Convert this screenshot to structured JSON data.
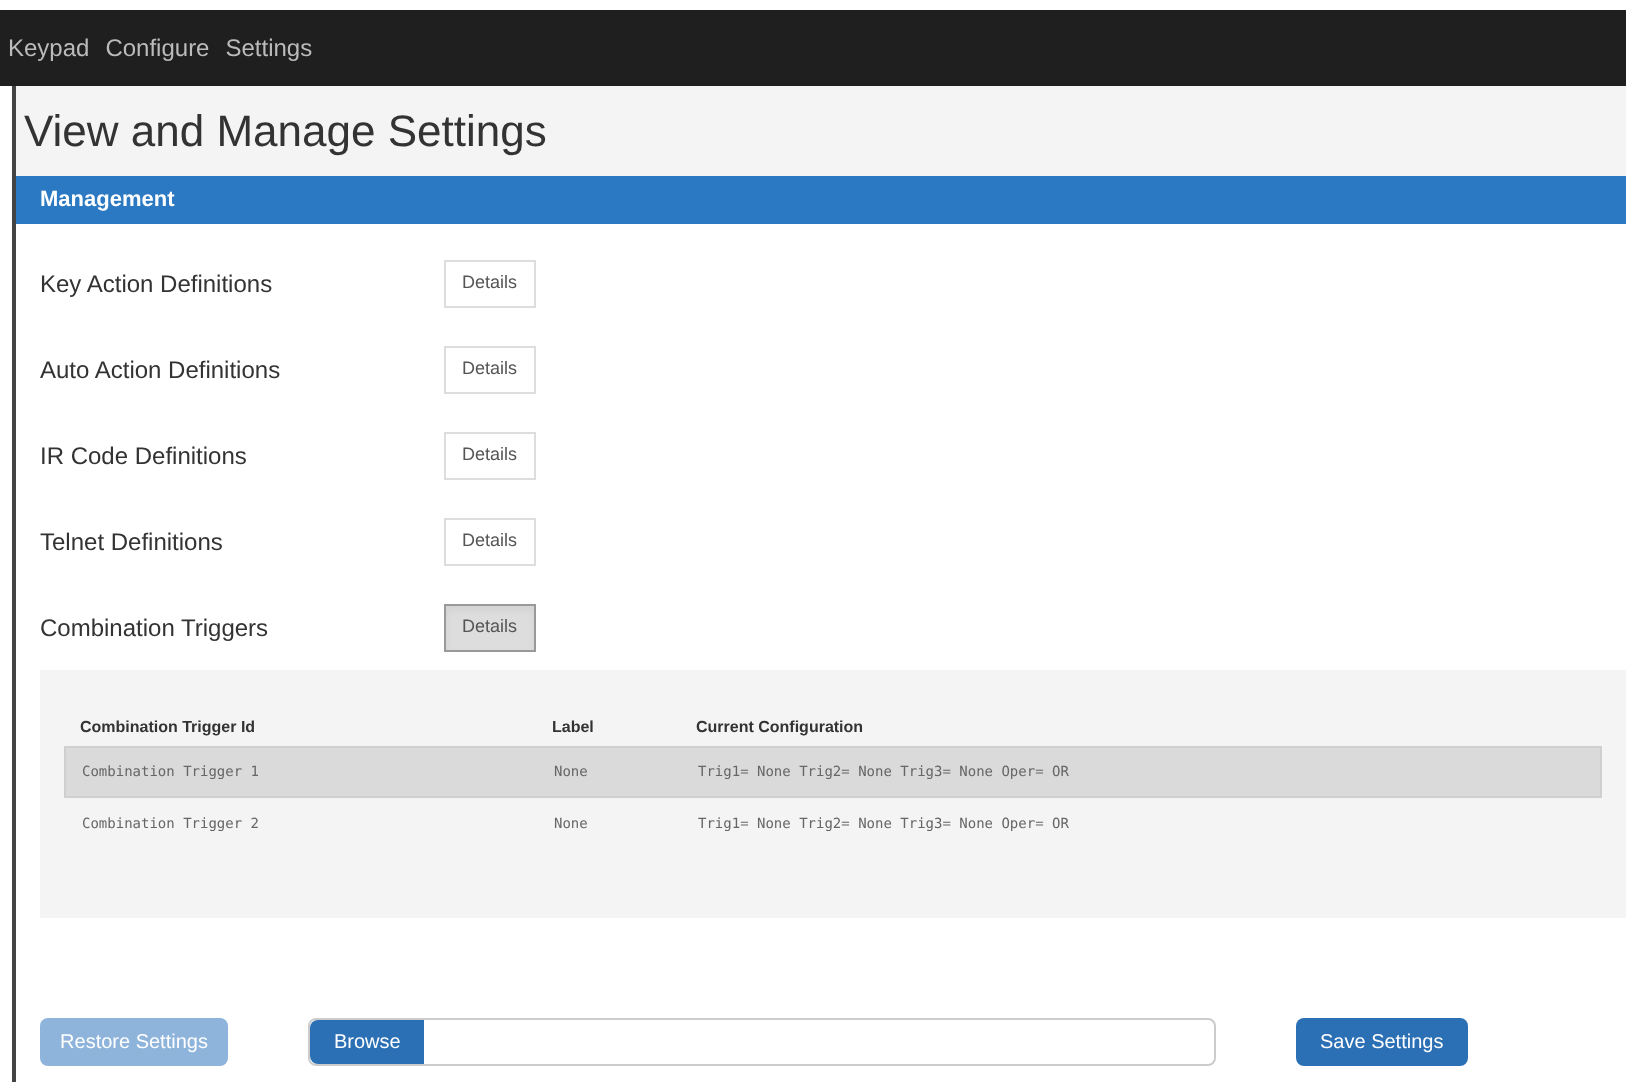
{
  "nav": [
    {
      "label": "Keypad"
    },
    {
      "label": "Configure"
    },
    {
      "label": "Settings"
    }
  ],
  "page_title": "View and Manage Settings",
  "panel": {
    "title": "Management",
    "items": [
      {
        "label": "Key Action Definitions",
        "button": "Details",
        "expanded": false
      },
      {
        "label": "Auto Action Definitions",
        "button": "Details",
        "expanded": false
      },
      {
        "label": "IR Code Definitions",
        "button": "Details",
        "expanded": false
      },
      {
        "label": "Telnet Definitions",
        "button": "Details",
        "expanded": false
      },
      {
        "label": "Combination Triggers",
        "button": "Details",
        "expanded": true
      }
    ],
    "table": {
      "columns": [
        "Combination Trigger Id",
        "Label",
        "Current Configuration"
      ],
      "rows": [
        {
          "cells": [
            "Combination Trigger 1",
            "None",
            "Trig1= None Trig2= None Trig3= None Oper= OR"
          ],
          "selected": true
        },
        {
          "cells": [
            "Combination Trigger 2",
            "None",
            "Trig1= None Trig2= None Trig3= None Oper= OR"
          ],
          "selected": false
        }
      ]
    }
  },
  "footer": {
    "restore": {
      "label": "Restore Settings",
      "disabled": true
    },
    "browse": "Browse",
    "save": "Save Settings"
  }
}
